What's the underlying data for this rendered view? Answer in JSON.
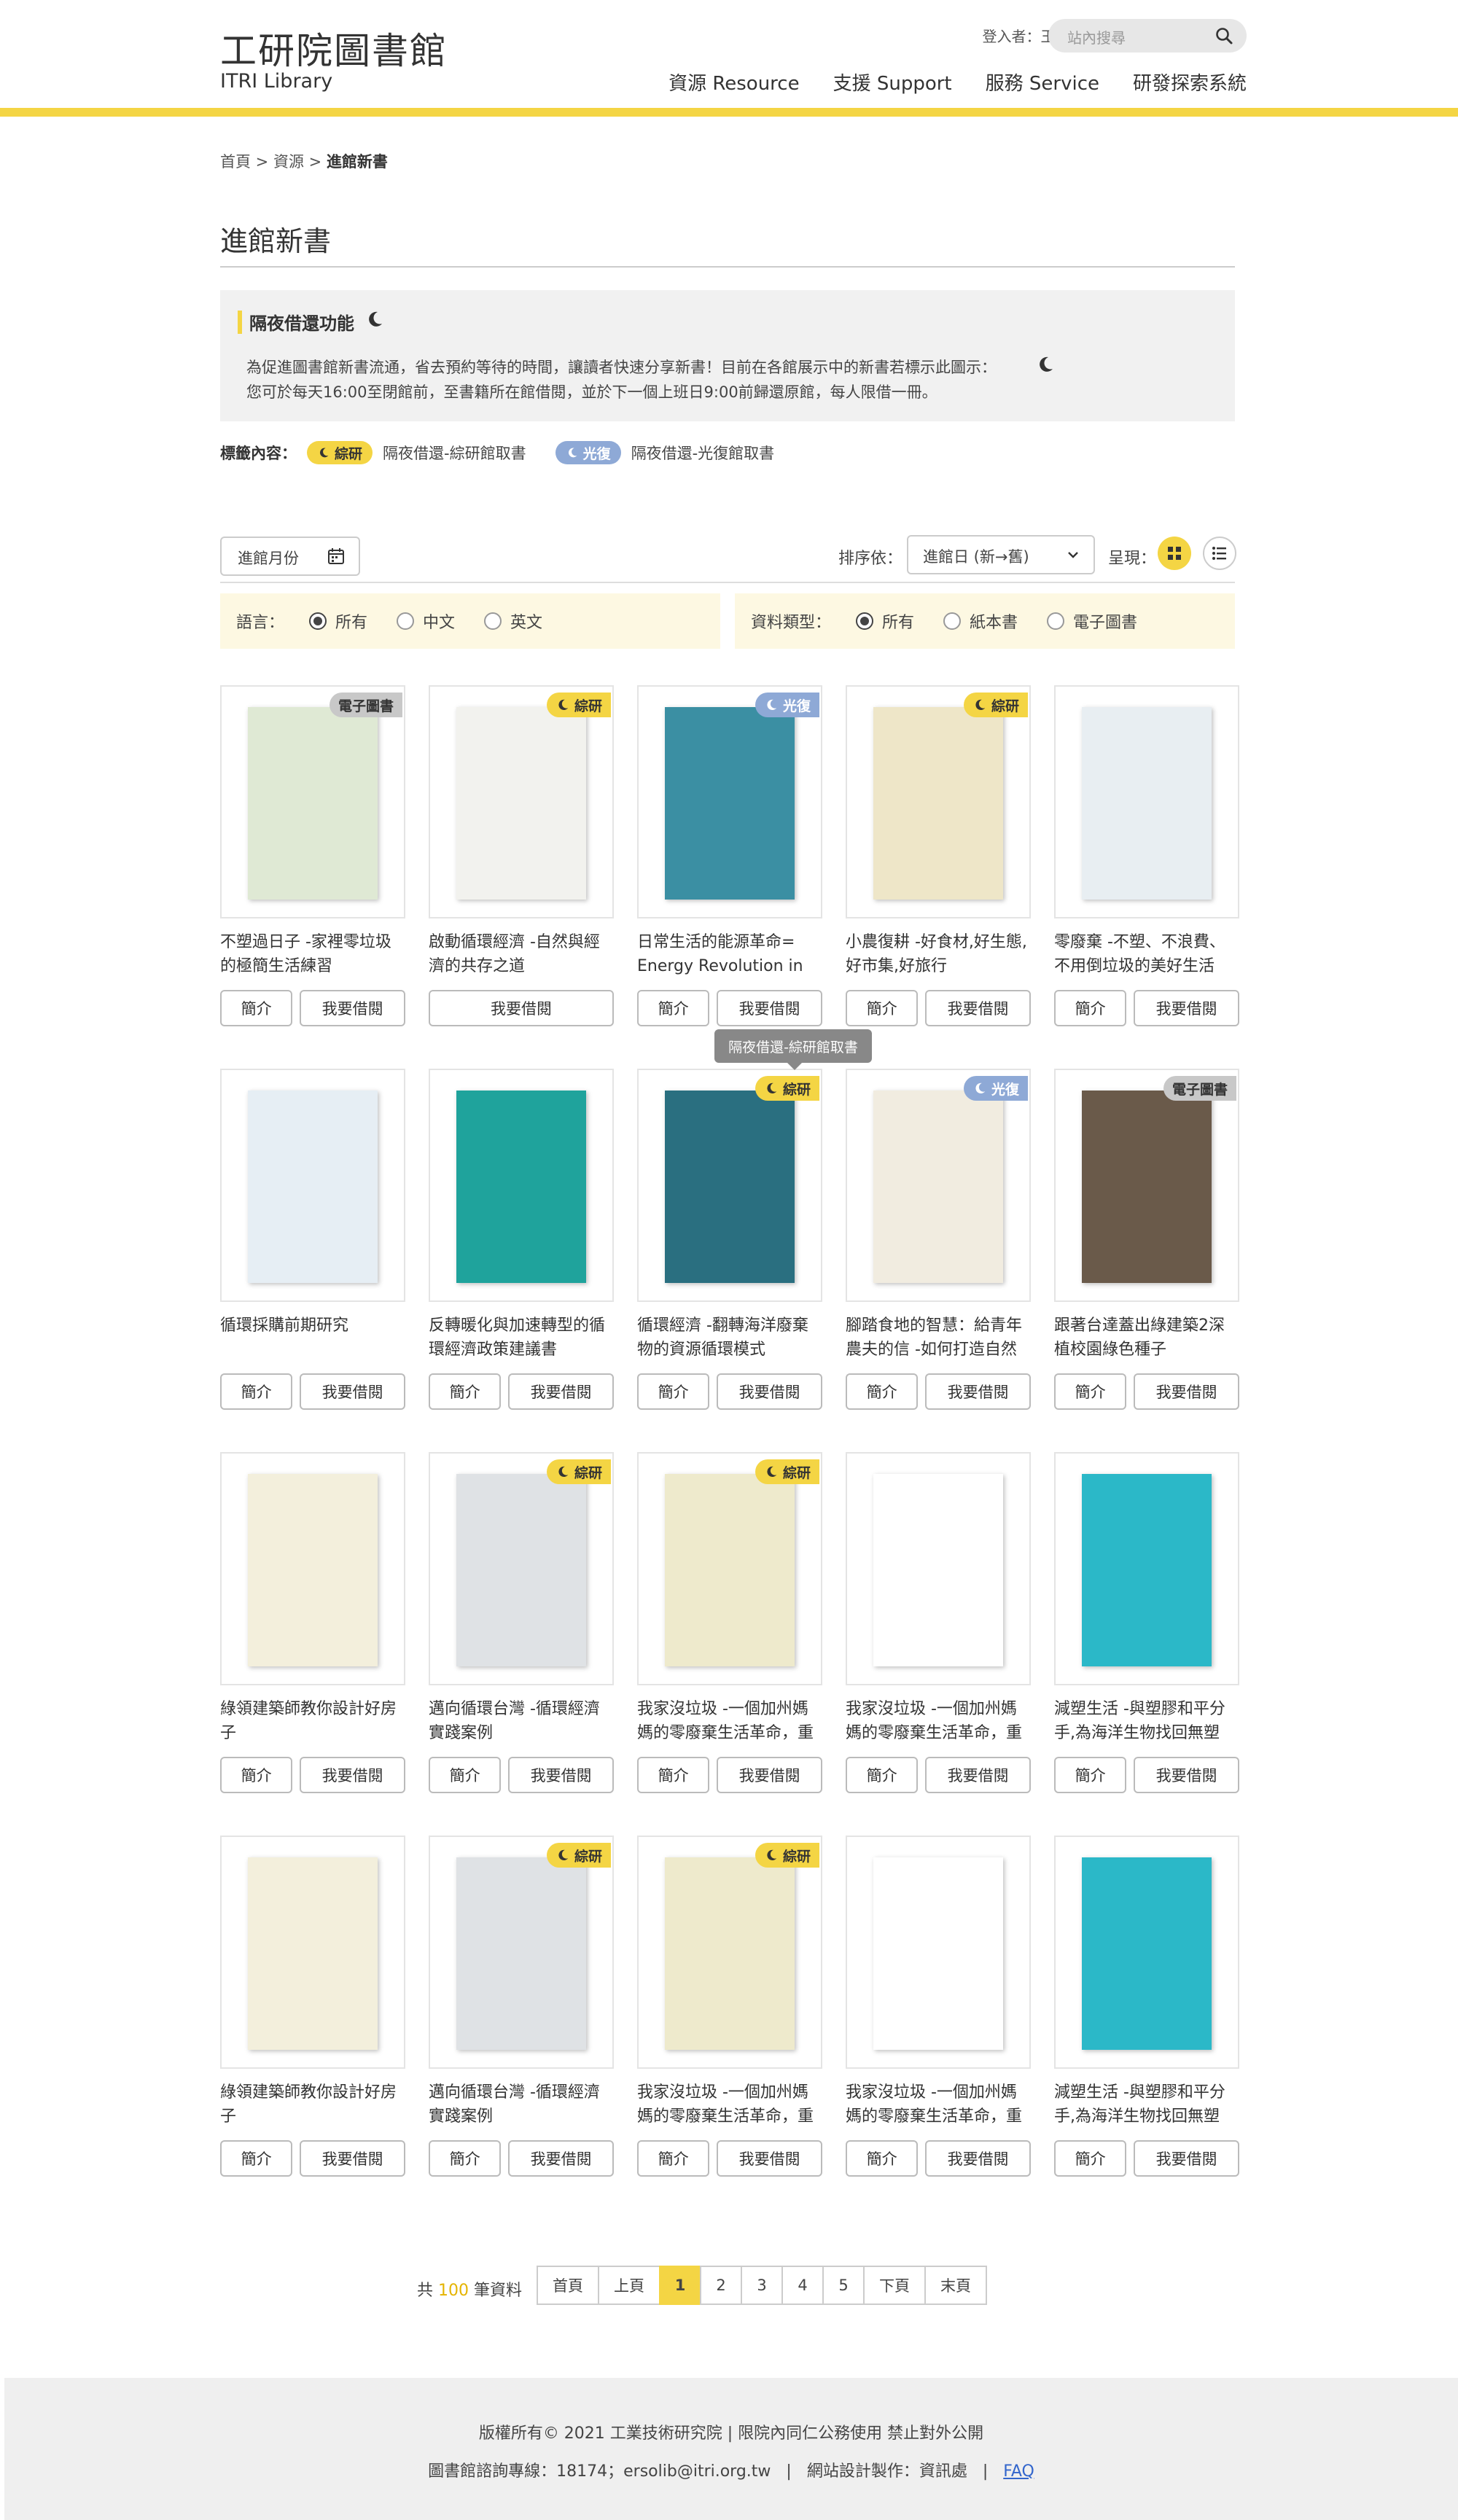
{
  "header": {
    "title": "工研院圖書館",
    "subtitle": "ITRI Library",
    "user": "登入者：王小明",
    "link": "itriweb",
    "search_placeholder": "站內搜尋",
    "nav": [
      "資源 Resource",
      "支援 Support",
      "服務 Service",
      "研發探索系統"
    ]
  },
  "breadcrumb": {
    "home": "首頁",
    "sep": " > ",
    "level1": "資源",
    "current": "進館新書"
  },
  "page_title": "進館新書",
  "notice": {
    "title": "隔夜借還功能",
    "line1": "為促進圖書館新書流通，省去預約等待的時間，讓讀者快速分享新書！目前在各館展示中的新書若標示此圖示：",
    "line2": "您可於每天16:00至閉館前，至書籍所在館借閱，並於下一個上班日9:00前歸還原館，每人限借一冊。"
  },
  "legend": {
    "label": "標籤內容：",
    "tag1": "綜研",
    "tag1_text": "隔夜借還-綜研館取書",
    "tag2": "光復",
    "tag2_text": "隔夜借還-光復館取書"
  },
  "toolbar": {
    "month_label": "進館月份",
    "sort_label": "排序依：",
    "sort_value": "進館日 (新→舊)",
    "view_label": "呈現："
  },
  "filters": {
    "language_label": "語言：",
    "language_options": [
      "所有",
      "中文",
      "英文"
    ],
    "language_selected": "所有",
    "type_label": "資料類型：",
    "type_options": [
      "所有",
      "紙本書",
      "電子圖書"
    ],
    "type_selected": "所有"
  },
  "buttons": {
    "intro": "簡介",
    "borrow": "我要借閱"
  },
  "tooltip": "隔夜借還-綜研館取書",
  "books": [
    {
      "title": "不塑過日子 -家裡零垃圾的極簡生活練習",
      "badge": "電子圖書",
      "badge_type": "g",
      "color": "#dfe9d4"
    },
    {
      "title": "啟動循環經濟 -自然與經濟的共存之道",
      "badge": "綜研",
      "badge_type": "y",
      "color": "#f2f2ee"
    },
    {
      "title": "日常生活的能源革命= Energy Revolution in Daily Life",
      "badge": "光復",
      "badge_type": "b",
      "color": "#3b8fa3"
    },
    {
      "title": "小農復耕 -好食材,好生態,好市集,好旅行",
      "badge": "綜研",
      "badge_type": "y",
      "color": "#eee6c8"
    },
    {
      "title": "零廢棄 -不塑、不浪費、不用倒垃圾的美好生活",
      "badge": "",
      "badge_type": "",
      "color": "#e8eef2"
    },
    {
      "title": "循環採購前期研究",
      "badge": "",
      "badge_type": "",
      "color": "#e6eef4"
    },
    {
      "title": "反轉暖化與加速轉型的循環經濟政策建議書",
      "badge": "",
      "badge_type": "",
      "color": "#1fa39c"
    },
    {
      "title": "循環經濟 -翻轉海洋廢棄物的資源循環模式",
      "badge": "綜研",
      "badge_type": "y",
      "color": "#2a6f80"
    },
    {
      "title": "腳踏食地的智慧：給青年農夫的信 -如何打造自然",
      "badge": "光復",
      "badge_type": "b",
      "color": "#f1ece0"
    },
    {
      "title": "跟著台達蓋出綠建築2深植校園綠色種子",
      "badge": "電子圖書",
      "badge_type": "g",
      "color": "#6a5a4a"
    },
    {
      "title": "綠領建築師教你設計好房子",
      "badge": "",
      "badge_type": "",
      "color": "#f3efdc"
    },
    {
      "title": "邁向循環台灣 -循環經濟實踐案例",
      "badge": "綜研",
      "badge_type": "y",
      "color": "#dfe2e5"
    },
    {
      "title": "我家沒垃圾 -一個加州媽媽的零廢棄生活革命，重",
      "badge": "綜研",
      "badge_type": "y",
      "color": "#eeeacc"
    },
    {
      "title": "我家沒垃圾 -一個加州媽媽的零廢棄生活革命，重",
      "badge": "",
      "badge_type": "",
      "color": "#ffffff"
    },
    {
      "title": "減塑生活 -與塑膠和平分手,為海洋生物找回無塑",
      "badge": "",
      "badge_type": "",
      "color": "#2bb8c8"
    },
    {
      "title": "綠領建築師教你設計好房子",
      "badge": "",
      "badge_type": "",
      "color": "#f3efdc"
    },
    {
      "title": "邁向循環台灣 -循環經濟實踐案例",
      "badge": "綜研",
      "badge_type": "y",
      "color": "#dfe2e5"
    },
    {
      "title": "我家沒垃圾 -一個加州媽媽的零廢棄生活革命，重",
      "badge": "綜研",
      "badge_type": "y",
      "color": "#eeeacc"
    },
    {
      "title": "我家沒垃圾 -一個加州媽媽的零廢棄生活革命，重",
      "badge": "",
      "badge_type": "",
      "color": "#ffffff"
    },
    {
      "title": "減塑生活 -與塑膠和平分手,為海洋生物找回無塑",
      "badge": "",
      "badge_type": "",
      "color": "#2bb8c8"
    }
  ],
  "pagination": {
    "total_prefix": "共",
    "total": "100",
    "total_suffix": "筆資料",
    "first": "首頁",
    "prev": "上頁",
    "pages": [
      "1",
      "2",
      "3",
      "4",
      "5"
    ],
    "current": "1",
    "next": "下頁",
    "last": "末頁"
  },
  "footer": {
    "line1": "版權所有© 2021 工業技術研究院 | 限院內同仁公務使用 禁止對外公開",
    "line2_a": "圖書館諮詢專線：18174；ersolib@itri.org.tw",
    "line2_b": "網站設計製作：資訊處",
    "faq": "FAQ"
  },
  "colors": {
    "accent": "#f4d544",
    "tag_blue": "#8ea9d6",
    "panel": "#f1f1f1",
    "filter_bg": "#fdf8e2"
  },
  "icons": [
    "search-icon",
    "moon-icon",
    "calendar-icon",
    "chevron-down-icon",
    "grid-view-icon",
    "list-view-icon"
  ]
}
